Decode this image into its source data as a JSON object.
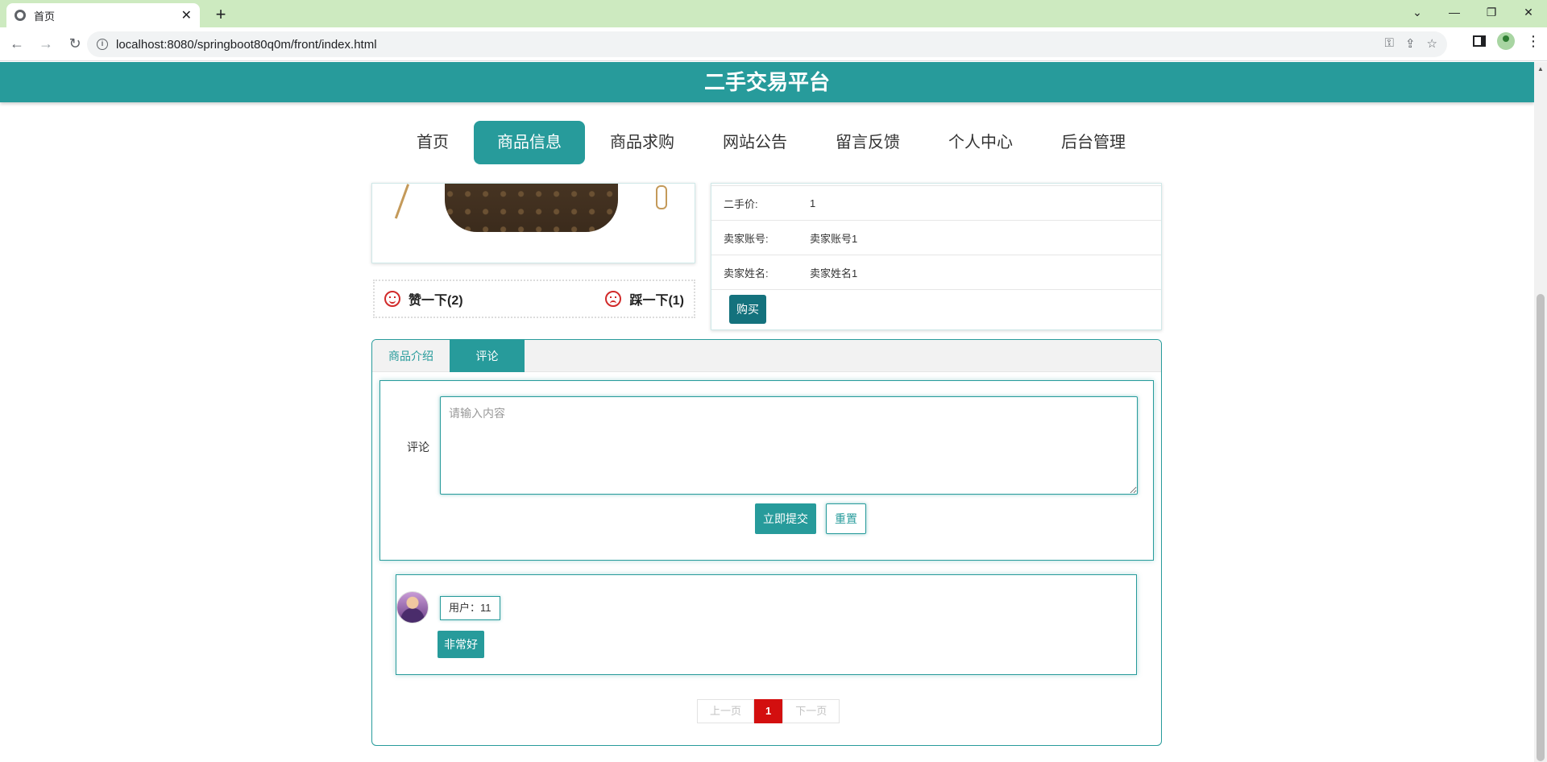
{
  "browser": {
    "tab_title": "首页",
    "url": "localhost:8080/springboot80q0m/front/index.html"
  },
  "site": {
    "title": "二手交易平台",
    "nav": [
      "首页",
      "商品信息",
      "商品求购",
      "网站公告",
      "留言反馈",
      "个人中心",
      "后台管理"
    ],
    "active_nav": "商品信息"
  },
  "product": {
    "rows": [
      {
        "label": "二手价:",
        "value": "1"
      },
      {
        "label": "卖家账号:",
        "value": "卖家账号1"
      },
      {
        "label": "卖家姓名:",
        "value": "卖家姓名1"
      }
    ],
    "buy_label": "购买",
    "like_label": "赞一下(2)",
    "dislike_label": "踩一下(1)"
  },
  "tabs": {
    "intro": "商品介绍",
    "comment": "评论"
  },
  "comment_form": {
    "label": "评论",
    "placeholder": "请输入内容",
    "submit": "立即提交",
    "reset": "重置"
  },
  "comments": [
    {
      "user": "用户：11",
      "text": "非常好"
    }
  ],
  "pager": {
    "prev": "上一页",
    "current": "1",
    "next": "下一页"
  },
  "colors": {
    "accent": "#279b9b",
    "buy": "#14727d",
    "page_current": "#d30f0f"
  }
}
